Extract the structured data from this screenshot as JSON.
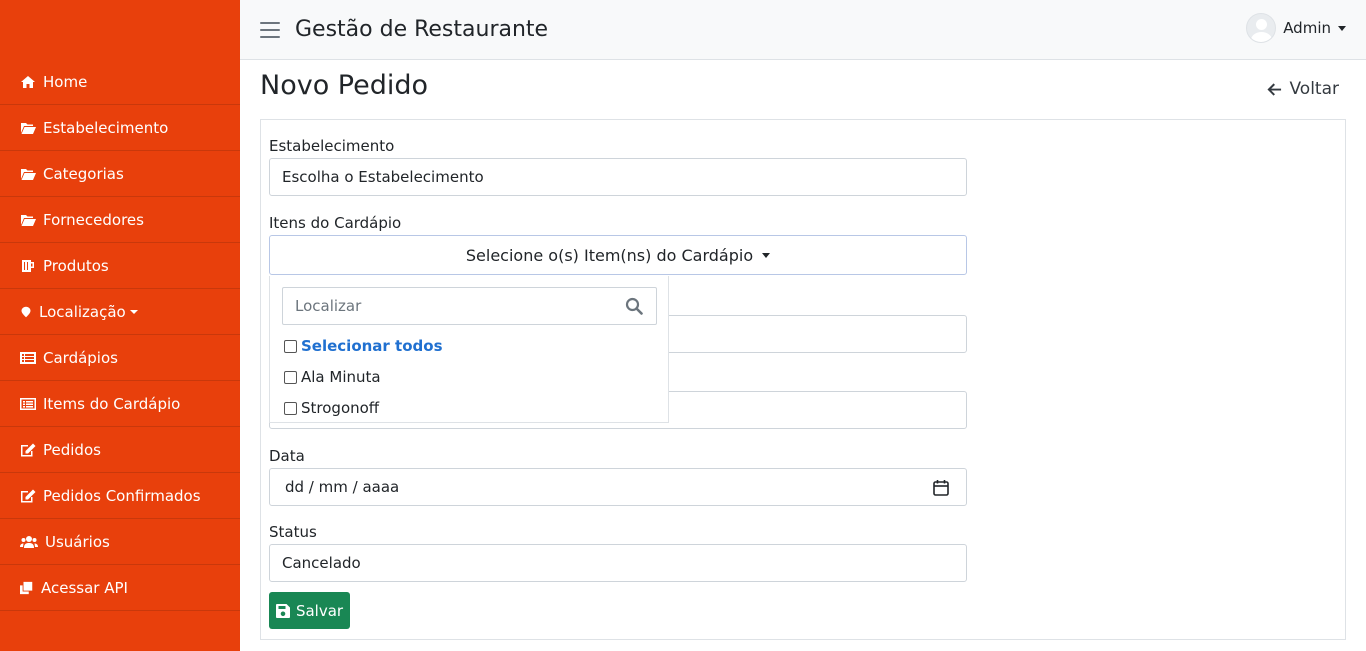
{
  "app": {
    "title": "Gestão de Restaurante"
  },
  "user": {
    "name": "Admin"
  },
  "sidebar": {
    "items": [
      {
        "label": "Home",
        "icon": "home-icon"
      },
      {
        "label": "Estabelecimento",
        "icon": "folder-open-icon"
      },
      {
        "label": "Categorias",
        "icon": "folder-open-icon"
      },
      {
        "label": "Fornecedores",
        "icon": "folder-open-icon"
      },
      {
        "label": "Produtos",
        "icon": "mug-icon"
      },
      {
        "label": "Localização",
        "icon": "map-marker-icon"
      },
      {
        "label": "Cardápios",
        "icon": "list-icon"
      },
      {
        "label": "Items do Cardápio",
        "icon": "list-alt-icon"
      },
      {
        "label": "Pedidos",
        "icon": "edit-icon"
      },
      {
        "label": "Pedidos Confirmados",
        "icon": "edit-icon"
      },
      {
        "label": "Usuários",
        "icon": "users-icon"
      },
      {
        "label": "Acessar API",
        "icon": "clone-icon"
      }
    ]
  },
  "page": {
    "title": "Novo Pedido",
    "back_label": "Voltar"
  },
  "form": {
    "establishment": {
      "label": "Estabelecimento",
      "value": "Escolha o Estabelecimento"
    },
    "menu_items": {
      "label": "Itens do Cardápio",
      "button": "Selecione o(s) Item(ns) do Cardápio",
      "search_placeholder": "Localizar",
      "select_all": "Selecionar todos",
      "options": [
        "Ala Minuta",
        "Strogonoff"
      ]
    },
    "date": {
      "label": "Data",
      "value": "dd / mm / aaaa"
    },
    "status": {
      "label": "Status",
      "value": "Cancelado"
    },
    "save_label": "Salvar"
  },
  "colors": {
    "sidebar": "#e8400c",
    "save_button": "#198754",
    "select_all_link": "#2070d0"
  }
}
